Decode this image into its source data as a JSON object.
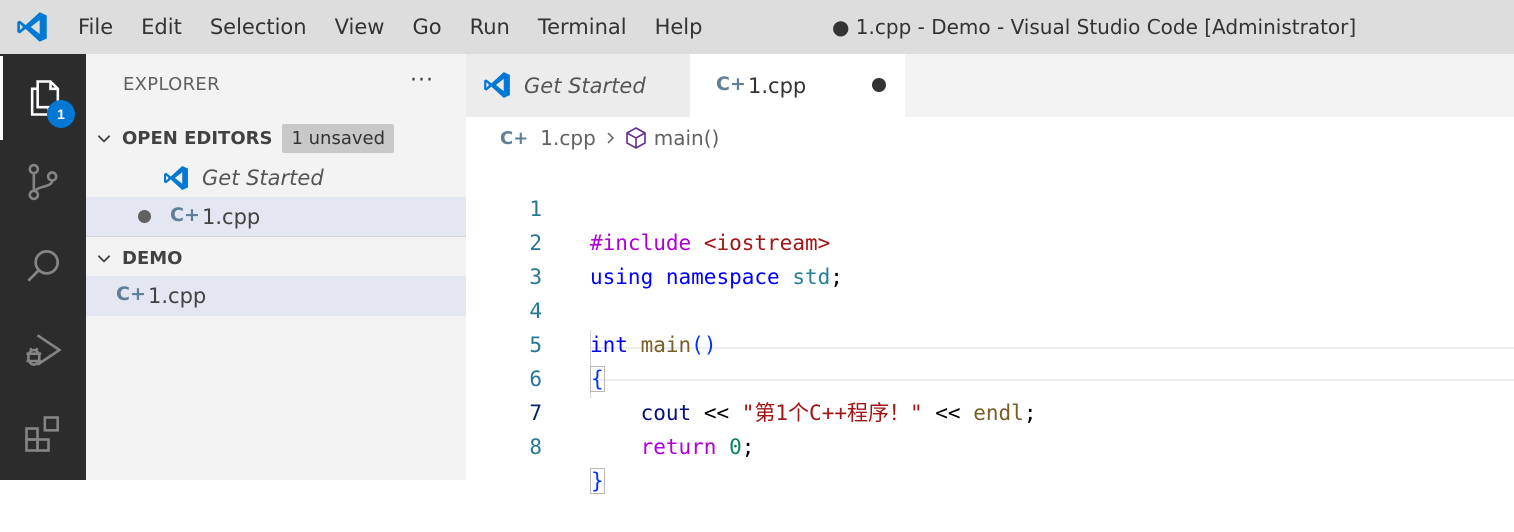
{
  "titlebar": {
    "menu": [
      "File",
      "Edit",
      "Selection",
      "View",
      "Go",
      "Run",
      "Terminal",
      "Help"
    ],
    "window_title": "● 1.cpp - Demo - Visual Studio Code [Administrator]"
  },
  "activity_bar": {
    "items": [
      "explorer-icon",
      "source-control-icon",
      "search-icon",
      "run-debug-icon",
      "extensions-icon"
    ],
    "explorer_badge": "1",
    "background": "#2c2c2c",
    "badge_color": "#0078d4"
  },
  "sidebar": {
    "title": "EXPLORER",
    "more": "···",
    "open_editors": {
      "label": "OPEN EDITORS",
      "badge": "1 unsaved",
      "items": [
        {
          "label": "Get Started",
          "icon": "vscode-icon"
        },
        {
          "label": "1.cpp",
          "icon": "cpp-icon",
          "unsaved": true
        }
      ]
    },
    "folder": {
      "label": "DEMO",
      "files": [
        {
          "label": "1.cpp",
          "icon": "cpp-icon"
        }
      ]
    }
  },
  "tabs": [
    {
      "label": "Get Started",
      "icon": "vscode-icon",
      "active": false
    },
    {
      "label": "1.cpp",
      "icon": "cpp-icon",
      "active": true,
      "dirty": true
    }
  ],
  "breadcrumb": {
    "file": "1.cpp",
    "symbol": "main()"
  },
  "editor": {
    "line_numbers": [
      "1",
      "2",
      "3",
      "4",
      "5",
      "6",
      "7",
      "8"
    ],
    "current_line": "7",
    "tokens": {
      "l1_directive": "#include",
      "l1_header": "<iostream>",
      "l2_using": "using",
      "l2_namespace": "namespace",
      "l2_std": "std",
      "l2_semi": ";",
      "l4_int": "int",
      "l4_main": "main",
      "l4_parens": "()",
      "l5_open": "{",
      "l6_cout": "cout",
      "l6_op1": "<<",
      "l6_string": "\"第1个C++程序！\"",
      "l6_op2": "<<",
      "l6_endl": "endl",
      "l6_semi": ";",
      "l7_return": "return",
      "l7_zero": "0",
      "l7_semi": ";",
      "l8_close": "}"
    },
    "colors": {
      "directive": "#af00db",
      "header": "#a31515",
      "keyword": "#0000ff",
      "namespace": "#267f99",
      "function": "#795e26",
      "variable": "#001080",
      "number": "#098658",
      "string": "#a31515",
      "line_number": "#237893"
    }
  }
}
